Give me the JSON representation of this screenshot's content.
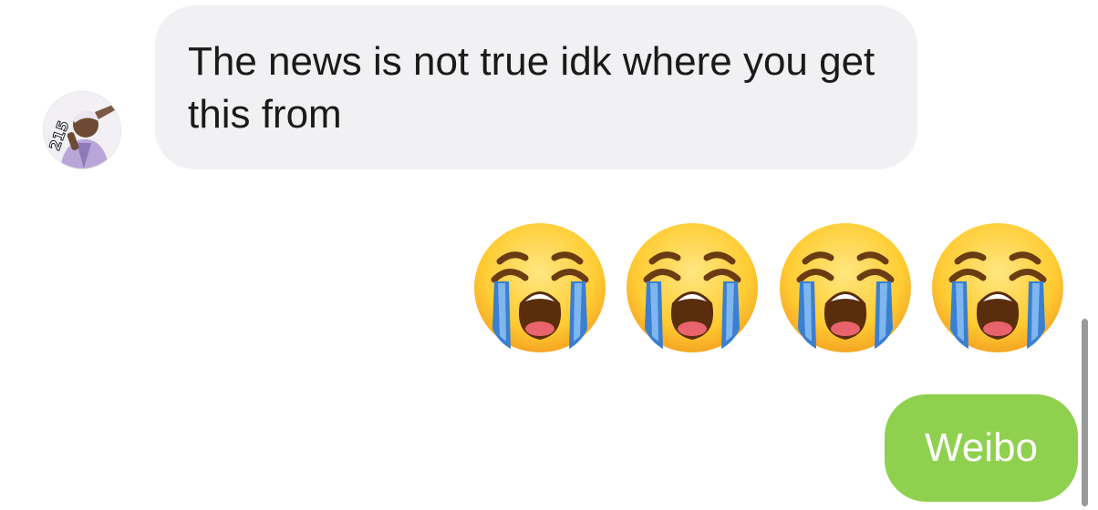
{
  "messages": {
    "incoming": {
      "text": "The news is not true idk where you get this from",
      "avatar_icon": "profile-photo-icon",
      "bubble_color": "#f1f1f3"
    },
    "emoji_message": {
      "emoji_icon": "loudly-crying-face-emoji",
      "count": 4
    },
    "outgoing": {
      "text": "Weibo",
      "bubble_color": "#8fd14f"
    }
  }
}
